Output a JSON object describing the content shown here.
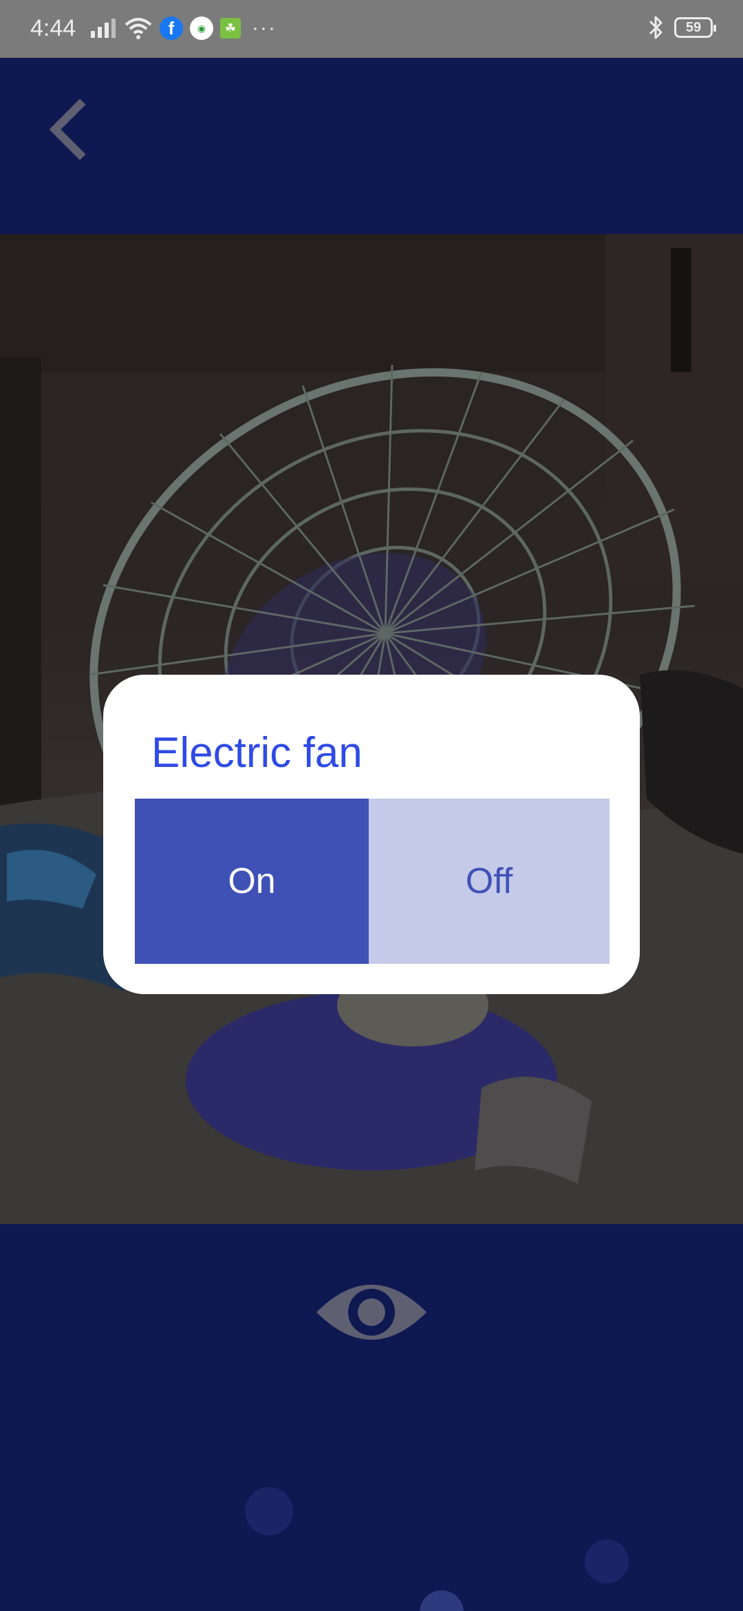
{
  "status_bar": {
    "time": "4:44",
    "battery": "59",
    "icons": [
      "signal-icon",
      "wifi-icon",
      "facebook-icon",
      "app-icon",
      "app-icon",
      "more-icon",
      "bluetooth-icon",
      "battery-icon"
    ],
    "more": "···"
  },
  "header": {
    "back_icon": "chevron-left-icon"
  },
  "dialog": {
    "title": "Electric fan",
    "on_label": "On",
    "off_label": "Off",
    "selected": "On"
  },
  "bottom": {
    "eye_icon": "eye-icon"
  },
  "colors": {
    "primary_dark": "#0e1851",
    "accent": "#3f51b5",
    "accent_light": "#c5cae9",
    "title_blue": "#2f4be6",
    "icon_gray": "#5f5f72"
  }
}
